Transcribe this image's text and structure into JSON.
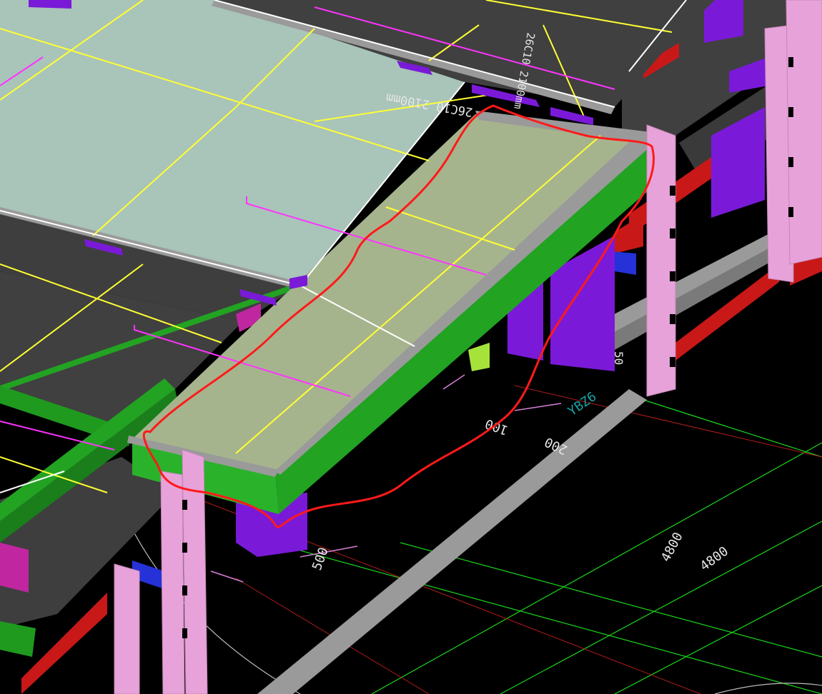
{
  "viewport": {
    "annotations": {
      "rebar_main": "26C10 2100mm",
      "rebar_side": "26C10 2100mm",
      "dim_100": "100",
      "dim_200": "200",
      "dim_500": "500",
      "dim_50": "50",
      "column_label": "YBZ6",
      "grid_dim_a": "4800",
      "grid_dim_b": "4800"
    },
    "colors": {
      "background": "#000000",
      "slab_main": "#a9c4b9",
      "slab_dark": "#404040",
      "highlight_slab": "#a6b48e",
      "beam_green": "#22a322",
      "beam_green_dark": "#1a8a1a",
      "column_pink": "#e7a3d9",
      "wall_purple": "#7a1ad8",
      "beam_red": "#c81818",
      "beam_blue": "#2432d8",
      "edge_gray": "#9a9a9a",
      "grid_green": "#19d619",
      "axis_yellow": "#ffff33",
      "rebar_magenta": "#ff33ff",
      "dim_violet": "#d77fd7",
      "markup_red": "#ff1a1a",
      "label_teal": "#19a4a4"
    }
  }
}
